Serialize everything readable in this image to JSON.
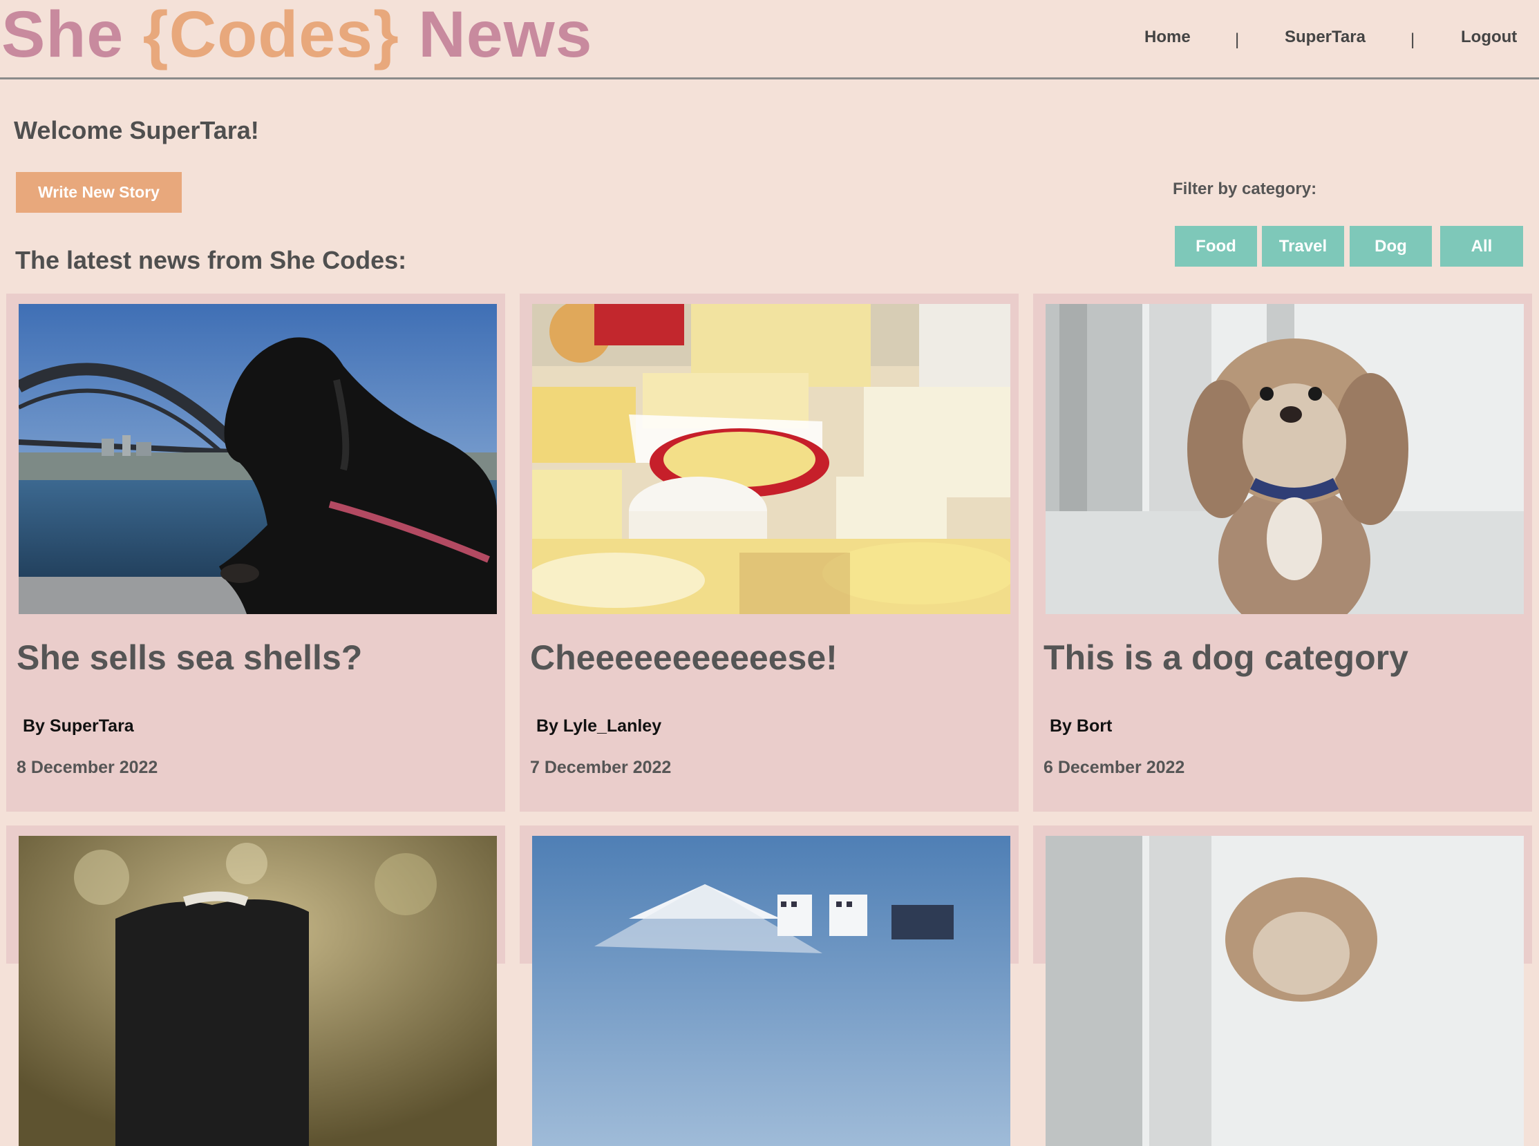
{
  "header": {
    "logo": {
      "part1": "She ",
      "part2": "{Codes}",
      "part3": " News"
    },
    "nav": {
      "home": "Home",
      "user": "SuperTara",
      "logout": "Logout",
      "separator": "|"
    }
  },
  "welcome": "Welcome SuperTara!",
  "write_button": "Write New Story",
  "latest_heading": "The latest news from She Codes:",
  "filter": {
    "label": "Filter by category:",
    "options": [
      "Food",
      "Travel",
      "Dog",
      "All"
    ]
  },
  "stories": [
    {
      "title": "She sells sea shells?",
      "author": "By SuperTara",
      "date": "8 December 2022",
      "image": "dog-at-harbour-bridge"
    },
    {
      "title": "Cheeeeeeeeeeese!",
      "author": "By Lyle_Lanley",
      "date": "7 December 2022",
      "image": "cheese-platter"
    },
    {
      "title": "This is a dog category",
      "author": "By Bort",
      "date": "6 December 2022",
      "image": "fluffy-dog"
    },
    {
      "image": "dog-blurred-background"
    },
    {
      "image": "mount-fuji-city"
    },
    {
      "image": "fluffy-dog"
    }
  ],
  "colors": {
    "background": "#f4e1d8",
    "card": "#eacdcb",
    "logo_pink": "#c88a9e",
    "logo_orange": "#e8a87c",
    "write_button": "#e8a87c",
    "filter_button": "#7ec8b9"
  }
}
